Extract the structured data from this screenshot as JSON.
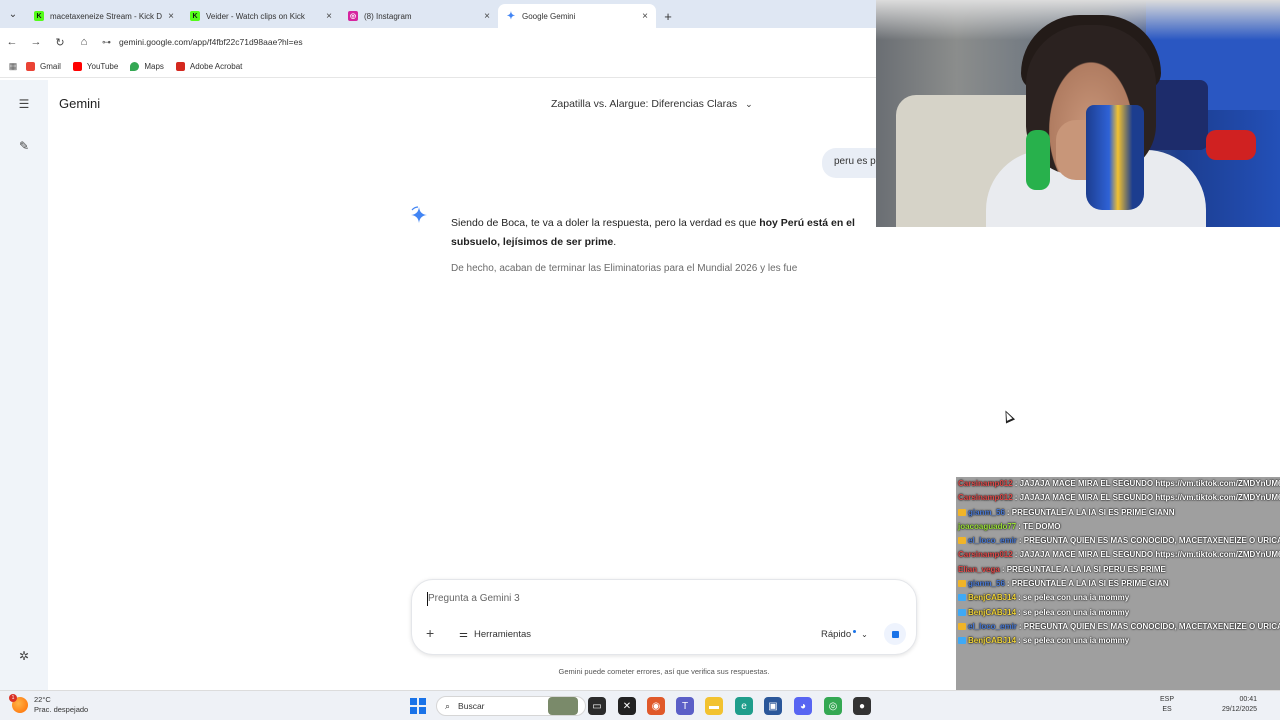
{
  "browser": {
    "tabs": [
      {
        "title": "macetaxeneize Stream - Kick D",
        "icon": "kick-icon",
        "color": "#53fc18",
        "glyph": "K"
      },
      {
        "title": "Veider - Watch clips on Kick",
        "icon": "kick-icon",
        "color": "#53fc18",
        "glyph": "K"
      },
      {
        "title": "(8) Instagram",
        "icon": "instagram-icon",
        "color": "#d6249f",
        "glyph": "◎"
      },
      {
        "title": "Google Gemini",
        "icon": "gemini-icon",
        "color": "#4285f4",
        "glyph": "✦"
      }
    ],
    "active_tab": 3,
    "url": "gemini.google.com/app/f4fbf22c71d98aae?hl=es",
    "bookmarks": [
      {
        "label": "Gmail",
        "icon": "gmail-icon",
        "color": "#ea4335"
      },
      {
        "label": "YouTube",
        "icon": "youtube-icon",
        "color": "#ff0000"
      },
      {
        "label": "Maps",
        "icon": "maps-icon",
        "color": "#34a853"
      },
      {
        "label": "Adobe Acrobat",
        "icon": "acrobat-icon",
        "color": "#d4281f"
      }
    ]
  },
  "gemini": {
    "brand": "Gemini",
    "conversation_title": "Zapatilla vs. Alargue: Diferencias Claras",
    "user_message": "peru es p",
    "answer_plain_1": "Siendo de Boca, te va a doler la respuesta, pero la verdad es que ",
    "answer_bold": "hoy Perú está en el subsuelo, lejísimos de ser prime",
    "answer_plain_2": ".",
    "answer_faded": "De hecho, acaban de terminar las Eliminatorias para el Mundial 2026 y les fue",
    "input_placeholder": "Pregunta a Gemini 3",
    "tools_label": "Herramientas",
    "mode_label": "Rápido",
    "disclaimer": "Gemini puede cometer errores, así que verifica sus respuestas."
  },
  "taskbar": {
    "temperature": "22°C",
    "weather": "Prac. despejado",
    "weather_badge": "1",
    "search_placeholder": "Buscar",
    "lang_1": "ESP",
    "lang_2": "ES",
    "time": "00:41",
    "date": "29/12/2025"
  },
  "chat": {
    "messages": [
      {
        "user": "Carsinamp012",
        "user_color": "#e04b4b",
        "badge": "",
        "text": ": JAJAJA MACE MIRA EL SEGUNDO https://vm.tiktok.com/ZMDYnUM6A/"
      },
      {
        "user": "Carsinamp012",
        "user_color": "#e04b4b",
        "badge": "",
        "text": ": JAJAJA MACE MIRA EL SEGUNDO https://vm.tiktok.com/ZMDYnUM6A/"
      },
      {
        "user": "gianm_56",
        "user_color": "#4b7bd6",
        "badge": "#f0b429",
        "text": ": PREGUNTALE A LA IA SI ES PRIME GIANN"
      },
      {
        "user": "joacoaguado77",
        "user_color": "#9be03a",
        "badge": "",
        "text": ": TE DOMO"
      },
      {
        "user": "el_loco_emir",
        "user_color": "#4b7bd6",
        "badge": "#f0b429",
        "text": ": PREGUNTA QUIEN ES MAS CONOCIDO, MACETAXENEIZE O URICARP9"
      },
      {
        "user": "Carsinamp012",
        "user_color": "#e04b4b",
        "badge": "",
        "text": ": JAJAJA MACE MIRA EL SEGUNDO https://vm.tiktok.com/ZMDYnUM6A/"
      },
      {
        "user": "Elian_vega",
        "user_color": "#e04b4b",
        "badge": "",
        "text": ": PREGUNTALE A LA IA SI PERU ES PRIME"
      },
      {
        "user": "gianm_56",
        "user_color": "#4b7bd6",
        "badge": "#f0b429",
        "text": ": PREGUNTALE A LA IA SI ES PRIME GIAN"
      },
      {
        "user": "BenjCABJ14",
        "user_color": "#f0d43a",
        "badge": "#3fa9f5",
        "text": ": se pelea con una ia mommy"
      },
      {
        "user": "BenjCABJ14",
        "user_color": "#f0d43a",
        "badge": "#3fa9f5",
        "text": ": se pelea con una ia mommy"
      },
      {
        "user": "el_loco_emir",
        "user_color": "#4b7bd6",
        "badge": "#f0b429",
        "text": ": PREGUNTA QUIEN ES MAS CONOCIDO, MACETAXENEIZE O URICARP9"
      },
      {
        "user": "BenjCABJ14",
        "user_color": "#f0d43a",
        "badge": "#3fa9f5",
        "text": ": se pelea con una ia mommy"
      }
    ]
  },
  "colors": {
    "accent": "#1a73e8",
    "rail_bg": "#f0f4f9",
    "tabbar_bg": "#dfe7f3"
  }
}
